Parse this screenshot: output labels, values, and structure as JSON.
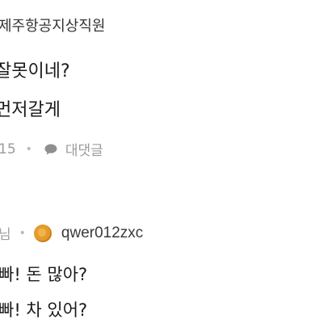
{
  "comment_1": {
    "username": "제주항공지상직원",
    "body_lines": [
      "잘못이네?",
      "먼저갈게"
    ],
    "like_count": "15",
    "reply_label": "대댓글"
  },
  "comment_2": {
    "prefix": "님",
    "username": "qwer012zxc",
    "body_lines": [
      "빠! 돈 많아?",
      "빠! 차 있어?"
    ]
  },
  "colors": {
    "text_primary": "#1a1a1a",
    "text_meta": "#9a9a9a",
    "avatar": "#e39b2a"
  },
  "icons": {
    "reply": "speech-bubble-icon",
    "avatar": "orange-circle-avatar"
  }
}
